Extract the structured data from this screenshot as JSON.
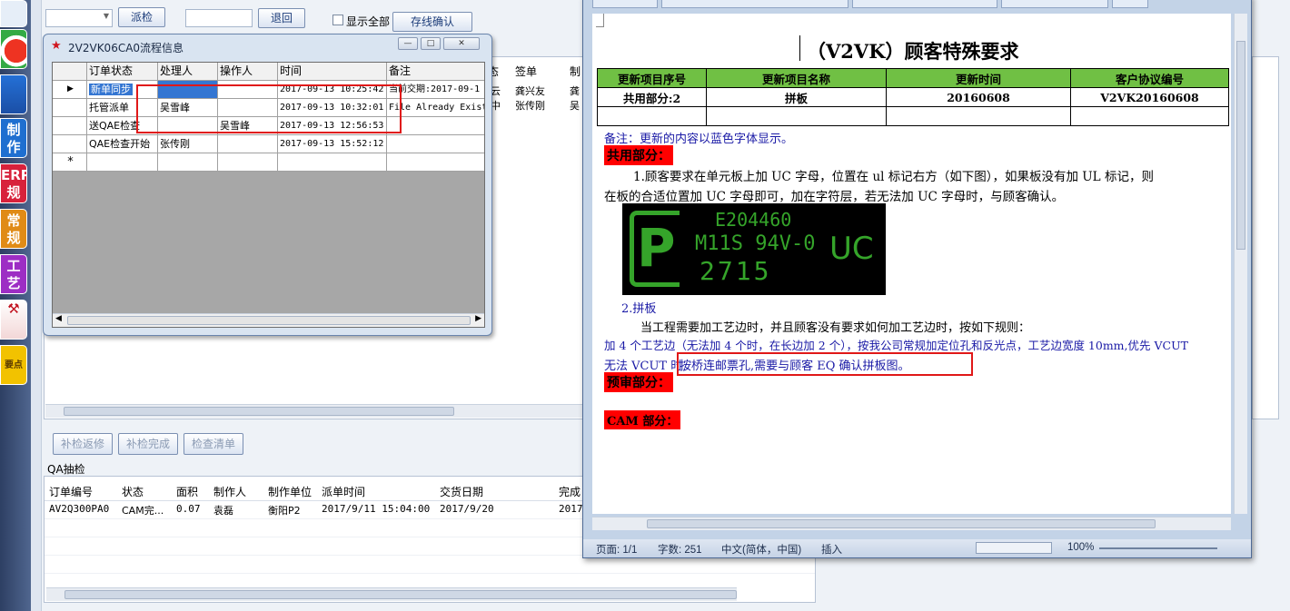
{
  "toolbar": {
    "dispatch": "派检",
    "return": "退回",
    "show_all": "显示全部",
    "online_confirm": "存线确认",
    "show_all_checked": false
  },
  "launcher": [
    {
      "label": "制作规范",
      "color": "#1f6fd0"
    },
    {
      "label": "ERP规范",
      "color": "#d8213b"
    },
    {
      "label": "常规问题",
      "color": "#e08b16"
    },
    {
      "label": "工艺能力",
      "color": "#9d2ec4"
    },
    {
      "label": "要点",
      "color": "#f2c200"
    }
  ],
  "bg_table": {
    "headers": [
      "签单",
      "制"
    ],
    "rows": [
      [
        "龚兴友",
        "龚"
      ],
      [
        "张传刚",
        "吴"
      ]
    ],
    "frag": [
      "云",
      "中"
    ]
  },
  "bottom_buttons": {
    "recheck": "补检返修",
    "recheck_done": "补检完成",
    "checklist": "检查清单"
  },
  "qa": {
    "label": "QA抽检",
    "headers": [
      "订单编号",
      "状态",
      "面积",
      "制作人",
      "制作单位",
      "派单时间",
      "交货日期",
      "完成"
    ],
    "rows": [
      [
        "AV2Q300PA0",
        "CAM完...",
        "0.07",
        "袁磊",
        "衡阳P2",
        "2017/9/11 15:04:00",
        "2017/9/20",
        "2017/"
      ]
    ]
  },
  "flow_window": {
    "title": "2V2VK06CA0流程信息",
    "min": "—",
    "max": "□",
    "close": "✕",
    "headers": [
      "订单状态",
      "处理人",
      "操作人",
      "时间",
      "备注"
    ],
    "rows": [
      [
        "新单同步",
        "",
        "",
        "2017-09-13 10:25:42",
        "当前交期:2017-09-1"
      ],
      [
        "托管派单",
        "吴雪峰",
        "",
        "2017-09-13 10:32:01",
        "File Already Exist"
      ],
      [
        "送QAE检查",
        "",
        "吴雪峰",
        "2017-09-13 12:56:53",
        ""
      ],
      [
        "QAE检查开始",
        "张传刚",
        "",
        "2017-09-13 15:52:12",
        ""
      ]
    ],
    "row_marker": "▶",
    "new_marker": "*"
  },
  "word": {
    "doc_title": "（V2VK）顾客特殊要求",
    "table": {
      "headers": [
        "更新项目序号",
        "更新项目名称",
        "更新时间",
        "客户协议编号"
      ],
      "row": [
        "共用部分:2",
        "拼板",
        "20160608",
        "V2VK20160608"
      ]
    },
    "note": "备注：更新的内容以蓝色字体显示。",
    "section_common": "共用部分：",
    "item1_line1": "1.顾客要求在单元板上加 UC 字母，位置在 ul 标记右方（如下图），如果板没有加 UL 标记，则",
    "item1_line2": "在板的合适位置加 UC 字母即可，加在字符层，若无法加 UC 字母时，与顾客确认。",
    "logo": {
      "line1": "E204460",
      "line2": "M11S 94V-0",
      "line3": "2715",
      "uc": "UC",
      "p": "P"
    },
    "item2": "2.拼板",
    "item2_line1": "当工程需要加工艺边时，并且顾客没有要求如何加工艺边时，按如下规则：",
    "item2_line2": "加 4 个工艺边（无法加 4 个时，在长边加 2 个），按我公司常规加定位孔和反光点，工艺边宽度 10mm,优先 VCUT",
    "item2_line3a": "无法 VCUT 时,",
    "item2_line3b": "按桥连邮票孔,需要与顾客 EQ 确认拼板图。",
    "section_pre": "预审部分：",
    "section_cam": "CAM 部分：",
    "status": {
      "page": "页面: 1/1",
      "words": "字数: 251",
      "lang": "中文(简体，中国)",
      "mode": "插入",
      "zoom": "100%"
    }
  }
}
